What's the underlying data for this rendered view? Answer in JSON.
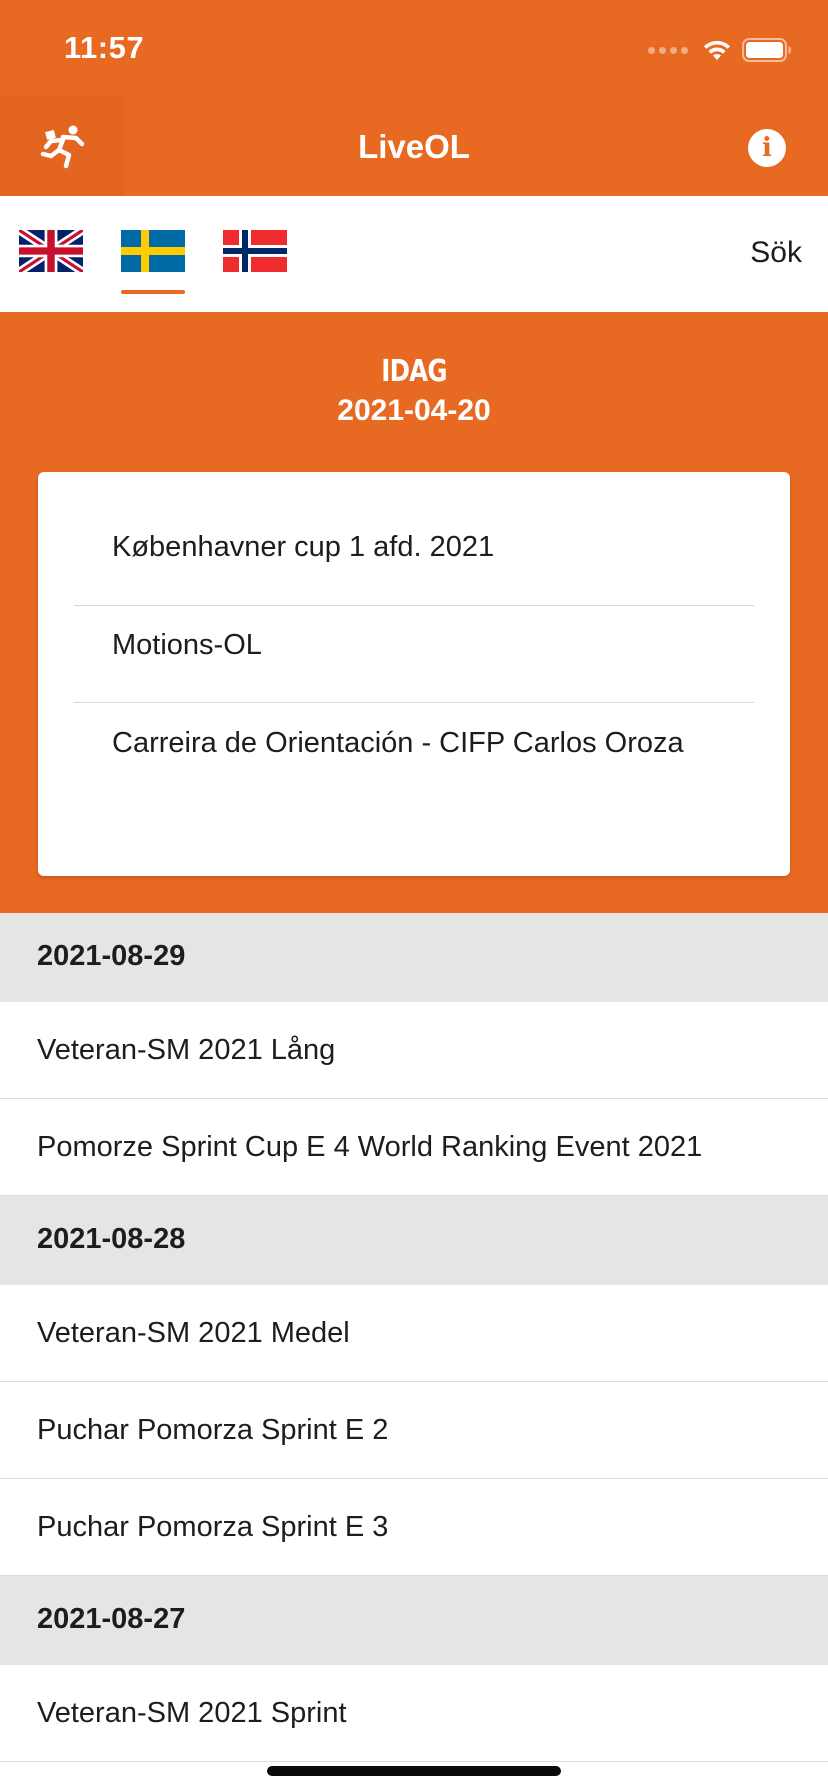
{
  "status_bar": {
    "time": "11:57"
  },
  "nav": {
    "title": "LiveOL",
    "logo_icon": "orienteering-runner-icon",
    "info_icon": "info-icon"
  },
  "languages": {
    "tabs": [
      {
        "name": "English",
        "flag": "uk-flag-icon"
      },
      {
        "name": "Svenska",
        "flag": "sweden-flag-icon",
        "selected": true
      },
      {
        "name": "Norsk",
        "flag": "norway-flag-icon"
      }
    ],
    "search_label": "Sök"
  },
  "today": {
    "label": "IDAG",
    "date": "2021-04-20",
    "events": [
      "København­er cup 1 afd. 2021",
      "Motions-OL",
      "Carreira de Orientación  - CIFP Carlos Oroza"
    ]
  },
  "groups": [
    {
      "date": "2021-08-29",
      "events": [
        "Veteran-SM 2021 Lång",
        "Pomorze Sprint Cup  E 4 World Ranking Event 2021"
      ]
    },
    {
      "date": "2021-08-28",
      "events": [
        "Veteran-SM 2021 Medel",
        "Puchar Pomorza Sprint E 2",
        "Puchar Pomorza Sprint E 3"
      ]
    },
    {
      "date": "2021-08-27",
      "events": [
        "Veteran-SM 2021 Sprint"
      ]
    }
  ],
  "colors": {
    "brand_orange": "#e86922",
    "header_gray": "#e5e5e5"
  }
}
